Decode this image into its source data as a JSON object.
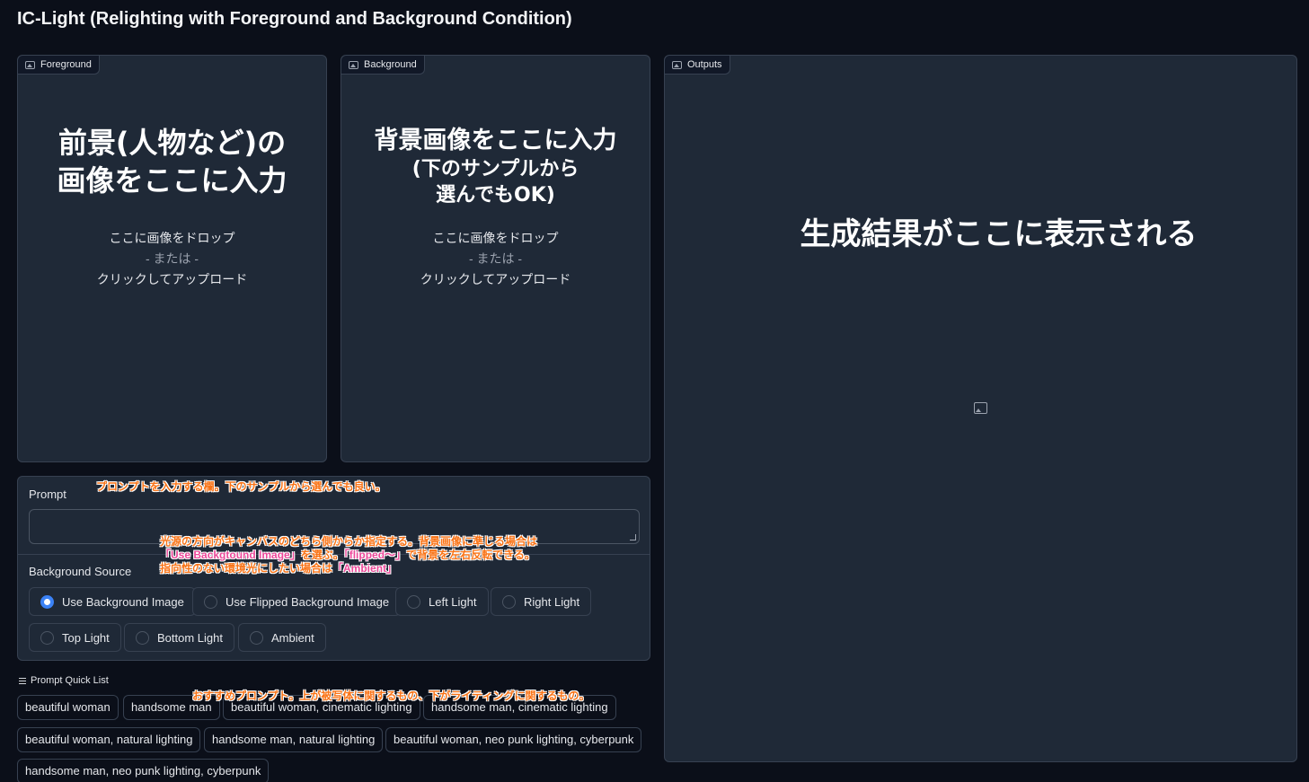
{
  "app_title": "IC-Light (Relighting with Foreground and Background Condition)",
  "foreground": {
    "label": "Foreground",
    "overlay_line1": "前景(人物など)の",
    "overlay_line2": "画像をここに入力",
    "drop_text": "ここに画像をドロップ",
    "or_text": "- または -",
    "upload_text": "クリックしてアップロード"
  },
  "background": {
    "label": "Background",
    "overlay_line1": "背景画像をここに入力",
    "overlay_line2": "(下のサンプルから",
    "overlay_line3": "選んでもOK)",
    "drop_text": "ここに画像をドロップ",
    "or_text": "- または -",
    "upload_text": "クリックしてアップロード"
  },
  "outputs": {
    "label": "Outputs",
    "overlay_text": "生成結果がここに表示される",
    "placeholder_icon": "image-icon"
  },
  "prompt": {
    "label": "Prompt",
    "value": "",
    "annotation": "プロンプトを入力する欄。下のサンプルから選んでも良い。"
  },
  "background_source": {
    "label": "Background Source",
    "options": [
      "Use Background Image",
      "Use Flipped Background Image",
      "Left Light",
      "Right Light",
      "Top Light",
      "Bottom Light",
      "Ambient"
    ],
    "selected": "Use Background Image",
    "annotation_line1": "光源の方向がキャンバスのどちら側からか指定する。背景画像に準じる場合は",
    "annotation_line2_a": "「Use Backgtound Image」",
    "annotation_line2_b": "を選ぶ。",
    "annotation_line2_c": "「flipped〜」",
    "annotation_line2_d": "で背景を左右反転できる。",
    "annotation_line3_a": "指向性のない環境光にしたい場合は",
    "annotation_line3_b": "「Ambient」"
  },
  "quick_list": {
    "label": "Prompt Quick List",
    "items": [
      "beautiful woman",
      "handsome man",
      "beautiful woman, cinematic lighting",
      "handsome man, cinematic lighting",
      "beautiful woman, natural lighting",
      "handsome man, natural lighting",
      "beautiful woman, neo punk lighting, cyberpunk",
      "handsome man, neo punk lighting, cyberpunk"
    ],
    "annotation": "おすすめプロンプト。上が被写体に関するもの、下がライティングに関するもの。"
  },
  "colors": {
    "background": "#0b0f19",
    "panel": "#1f2937",
    "border": "#374151",
    "accent": "#3b82f6",
    "annotation_orange": "#f97316",
    "annotation_pink": "#ec4899"
  }
}
